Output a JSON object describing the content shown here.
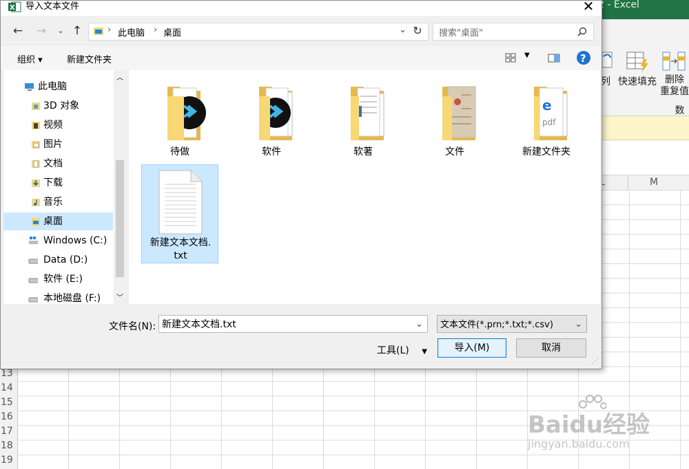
{
  "excel": {
    "title_right": "2  -  Excel",
    "ribbon": {
      "partial_btn": "列",
      "flash_fill": "快速填充",
      "remove_dup_line1": "删除",
      "remove_dup_line2": "重复值",
      "group_label": "数据"
    },
    "col_headers": [
      "L",
      "M"
    ],
    "row_headers": [
      "13",
      "14",
      "15",
      "16",
      "17",
      "18",
      "19"
    ]
  },
  "dialog": {
    "title": "导入文本文件",
    "close": "✕",
    "address": {
      "root": "此电脑",
      "sep": "›",
      "current": "桌面"
    },
    "search_placeholder": "搜索\"桌面\"",
    "toolbar": {
      "organize": "组织 ▾",
      "new_folder": "新建文件夹"
    },
    "nav": [
      {
        "label": "此电脑",
        "icon": "computer-icon"
      },
      {
        "label": "3D 对象",
        "icon": "3d-objects-icon"
      },
      {
        "label": "视频",
        "icon": "video-icon"
      },
      {
        "label": "图片",
        "icon": "pictures-icon"
      },
      {
        "label": "文档",
        "icon": "documents-icon"
      },
      {
        "label": "下载",
        "icon": "download-icon"
      },
      {
        "label": "音乐",
        "icon": "music-icon"
      },
      {
        "label": "桌面",
        "icon": "desktop-icon"
      },
      {
        "label": "Windows (C:)",
        "icon": "windows-drive-icon"
      },
      {
        "label": "Data (D:)",
        "icon": "drive-icon"
      },
      {
        "label": "软件 (E:)",
        "icon": "drive-icon"
      },
      {
        "label": "本地磁盘 (F:)",
        "icon": "drive-icon"
      }
    ],
    "files": [
      {
        "name": "待做",
        "type": "folder"
      },
      {
        "name": "软件",
        "type": "folder"
      },
      {
        "name": "软著",
        "type": "folder"
      },
      {
        "name": "文件",
        "type": "folder"
      },
      {
        "name": "新建文件夹",
        "type": "folder"
      },
      {
        "name": "新建文本文档.\ntxt",
        "type": "text-file"
      }
    ],
    "footer": {
      "filename_label": "文件名(N):",
      "filename_value": "新建文本文档.txt",
      "filetype": "文本文件(*.prn;*.txt;*.csv)",
      "tools": "工具(L)",
      "import": "导入(M)",
      "cancel": "取消"
    },
    "colors": {
      "selection": "#cce8ff",
      "selection_border": "#99d1ff",
      "folder": "#f8d775",
      "excel_green": "#217346"
    }
  },
  "watermark": {
    "brand": "Baidu经验",
    "url": "jingyan.baidu.com"
  }
}
